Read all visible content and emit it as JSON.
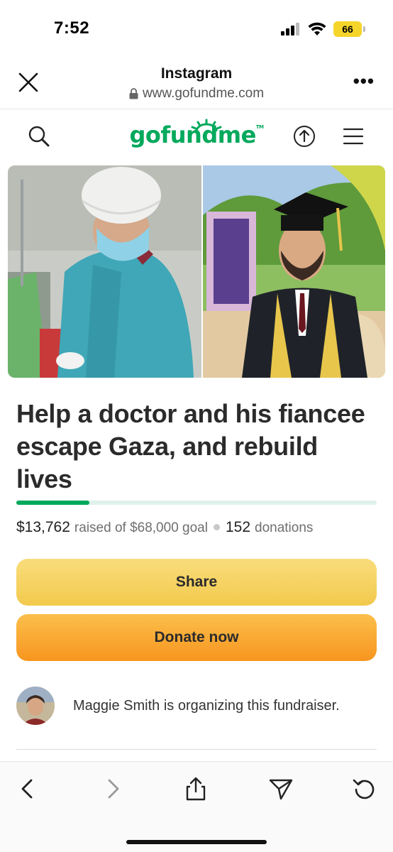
{
  "status_bar": {
    "time": "7:52",
    "battery": "66",
    "icons": [
      "signal-icon",
      "wifi-icon",
      "battery-icon"
    ]
  },
  "browser": {
    "title": "Instagram",
    "url": "www.gofundme.com",
    "icons": [
      "close-icon",
      "lock-icon",
      "more-icon"
    ]
  },
  "site_nav": {
    "logo": "gofundme",
    "logo_trademark": "TM",
    "icons": [
      "search-icon",
      "share-upload-icon",
      "menu-icon"
    ]
  },
  "campaign": {
    "title": "Help a doctor and his fiancee escape Gaza, and rebuild lives",
    "raised_amount": "$13,762",
    "raised_text": "raised of $68,000 goal",
    "donation_count": "152",
    "donations_label": "donations",
    "progress_fraction": 0.202
  },
  "actions": {
    "share_label": "Share",
    "donate_label": "Donate now"
  },
  "organizer": {
    "text": "Maggie Smith is organizing this fundraiser."
  },
  "toolbar": {
    "icons": [
      "back-icon",
      "forward-icon",
      "share-icon",
      "send-icon",
      "reload-icon"
    ]
  },
  "colors": {
    "brand_green": "#02a95c",
    "share_yellow": "#f2c94c",
    "donate_orange": "#f7951f",
    "battery_yellow": "#f5d52a"
  }
}
